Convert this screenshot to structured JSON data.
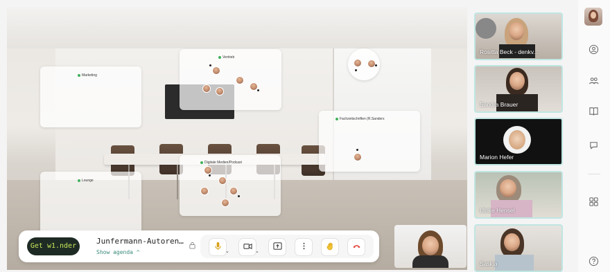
{
  "zones": [
    {
      "label": "Marketing"
    },
    {
      "label": "Vertrieb"
    },
    {
      "label": "Fachzeitschriften (R.Sanders"
    },
    {
      "label": "Lounge"
    },
    {
      "label": "Digitale Medien/Podcast"
    }
  ],
  "toolbar": {
    "brand": "Get w1.nder",
    "room_title": "Junfermann-Autoren…",
    "agenda_label": "Show agenda ^",
    "lock_icon": "lock-icon",
    "controls": [
      "microphone-icon",
      "camera-icon",
      "share-screen-icon",
      "more-icon",
      "reaction-hand-icon",
      "hang-up-icon"
    ],
    "hangup_color": "#e2483f"
  },
  "participants": [
    {
      "name": "Rositta Beck - denkv..."
    },
    {
      "name": "Sandra Brauer"
    },
    {
      "name": "Marion Hefer"
    },
    {
      "name": "Ulrike Hensel"
    },
    {
      "name": "Saskia"
    }
  ],
  "rail": {
    "icons": [
      "user-circle-icon",
      "people-icon",
      "book-icon",
      "chat-icon",
      "apps-icon",
      "help-icon"
    ]
  },
  "accent": "#bfe6e2"
}
